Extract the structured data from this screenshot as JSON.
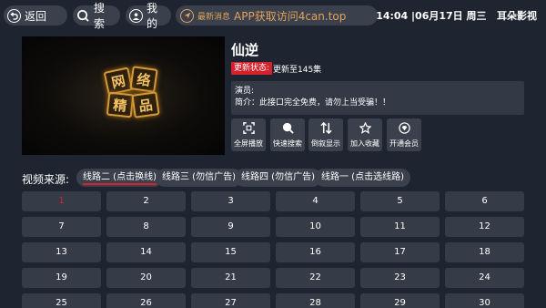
{
  "topbar": {
    "back_label": "返回",
    "search_label": "搜索",
    "mine_label": "我的",
    "message_label": "最新消息",
    "message_text": "APP获取访问4can.top",
    "clock_text": "14:04 |06月17日 周三",
    "app_name": "耳朵影视",
    "colors": {
      "accent": "#e3a25d",
      "pill_bg": "#3a414c"
    }
  },
  "detail": {
    "title": "仙逆",
    "update_badge": "更新状态:",
    "update_text": "更新至145集",
    "actor_line": "演员:",
    "intro_line": "简介：此接口完全免费，请勿上当受骗！！",
    "actions": [
      {
        "icon": "fullscreen-icon",
        "label": "全屏播放"
      },
      {
        "icon": "search-icon",
        "label": "快速搜索"
      },
      {
        "icon": "sort-icon",
        "label": "倒叙显示"
      },
      {
        "icon": "star-icon",
        "label": "加入收藏"
      },
      {
        "icon": "vip-icon",
        "label": "开通会员"
      }
    ]
  },
  "source": {
    "label": "视频来源:",
    "lines": [
      {
        "label": "线路二 (点击换线)",
        "active": true
      },
      {
        "label": "线路三 (勿信广告)",
        "active": false
      },
      {
        "label": "线路四 (勿信广告)",
        "active": false
      },
      {
        "label": "线路一 (点击选线路)",
        "active": false
      }
    ]
  },
  "episodes": {
    "selected": "1",
    "items": [
      "1",
      "2",
      "3",
      "4",
      "5",
      "6",
      "7",
      "8",
      "9",
      "10",
      "11",
      "12",
      "13",
      "14",
      "15",
      "16",
      "17",
      "18",
      "19",
      "20",
      "21",
      "22",
      "23",
      "24",
      "25",
      "26",
      "27",
      "28",
      "29",
      "30"
    ]
  },
  "colors": {
    "background": "#1e2530",
    "red": "#d6202c"
  }
}
